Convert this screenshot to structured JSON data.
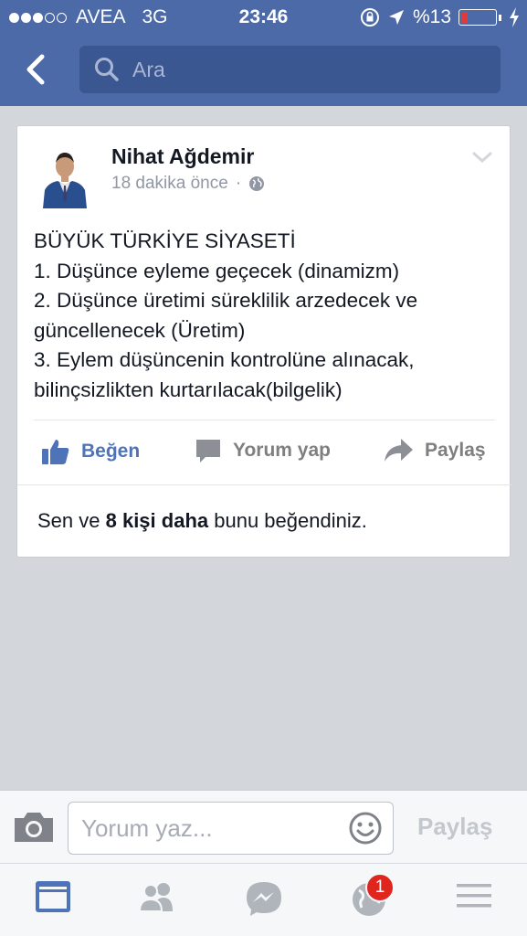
{
  "status_bar": {
    "carrier": "AVEA",
    "network": "3G",
    "time": "23:46",
    "battery": "%13",
    "battery_level": 0.13,
    "signal_bars": 3
  },
  "search": {
    "placeholder": "Ara"
  },
  "post": {
    "author": "Nihat Ağdemir",
    "time": "18 dakika önce",
    "separator": "·",
    "text_lines": [
      "BÜYÜK TÜRKİYE SİYASETİ",
      "1. Düşünce eyleme geçecek (dinamizm)",
      "2. Düşünce üretimi süreklilik arzedecek ve",
      "güncellenecek (Üretim)",
      "3. Eylem düşüncenin kontrolüne alınacak,",
      "bilinçsizlikten kurtarılacak(bilgelik)"
    ],
    "actions": {
      "like": "Beğen",
      "comment": "Yorum yap",
      "share": "Paylaş"
    },
    "likes": {
      "prefix": "Sen ve ",
      "bold": "8 kişi daha",
      "suffix": " bunu beğendiniz."
    }
  },
  "comment_bar": {
    "placeholder": "Yorum yaz...",
    "share": "Paylaş"
  },
  "tab_bar": {
    "notifications_badge": "1"
  },
  "colors": {
    "brand": "#4c6aa8",
    "like_blue": "#4e73b8",
    "badge_red": "#e0251f"
  },
  "icons": [
    "back-chevron-icon",
    "search-icon",
    "chevron-down-icon",
    "globe-icon",
    "thumbs-up-icon",
    "comment-icon",
    "share-arrow-icon",
    "camera-icon",
    "smiley-icon",
    "news-feed-icon",
    "friends-icon",
    "messenger-icon",
    "notifications-globe-icon",
    "menu-icon"
  ]
}
